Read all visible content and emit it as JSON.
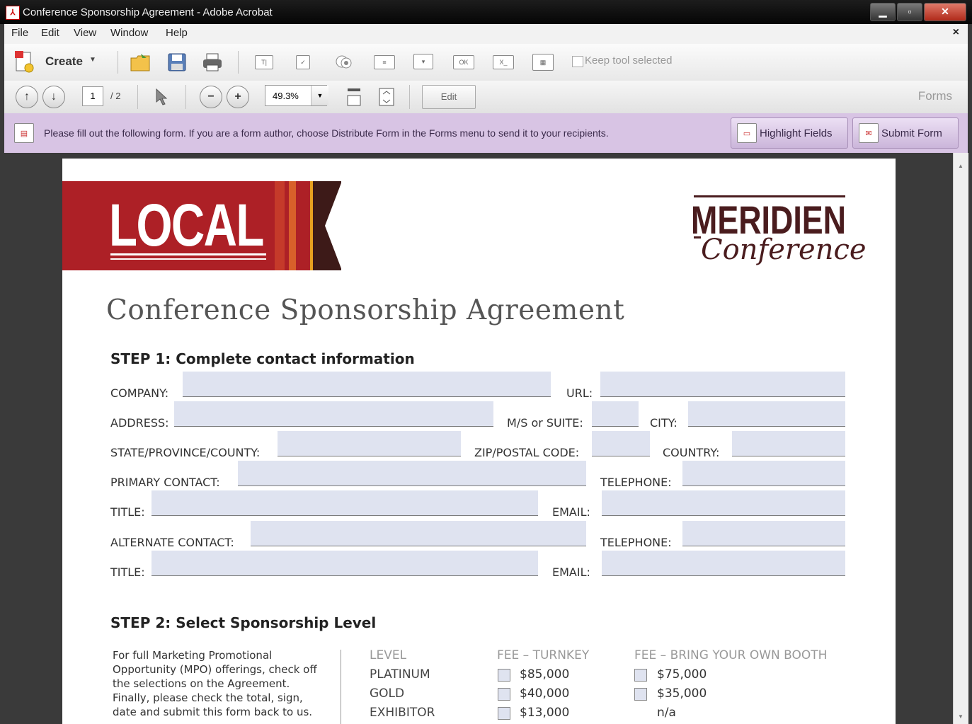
{
  "window": {
    "title": "Conference Sponsorship Agreement - Adobe Acrobat",
    "app_icon": "adobe-pdf-icon"
  },
  "menu": {
    "items": [
      "File",
      "Edit",
      "View",
      "Window",
      "Help"
    ],
    "close": "×"
  },
  "toolbar": {
    "create_label": "Create",
    "keep_tool_label": "Keep tool selected"
  },
  "nav": {
    "page_current": "1",
    "page_total": "/ 2",
    "zoom": "49.3%",
    "edit_label": "Edit",
    "forms_label": "Forms"
  },
  "formsbar": {
    "message": "Please fill out the following form. If you are a form author, choose Distribute Form in the Forms menu to send it to your recipients.",
    "highlight_label": "Highlight Fields",
    "submit_label": "Submit Form"
  },
  "document": {
    "banner_text": "LOCAL",
    "brand_main": "MERIDIEN",
    "brand_sub": "Conference",
    "title": "Conference Sponsorship Agreement",
    "step1": "STEP 1: Complete contact information",
    "labels": {
      "company": "COMPANY:",
      "url": "URL:",
      "address": "ADDRESS:",
      "suite": "M/S or SUITE:",
      "city": "CITY:",
      "state": "STATE/PROVINCE/COUNTY:",
      "zip": "ZIP/POSTAL CODE:",
      "country": "COUNTRY:",
      "primary": "PRIMARY CONTACT:",
      "telephone1": "TELEPHONE:",
      "title1": "TITLE:",
      "email1": "EMAIL:",
      "alternate": "ALTERNATE CONTACT:",
      "telephone2": "TELEPHONE:",
      "title2": "TITLE:",
      "email2": "EMAIL:"
    },
    "step2": "STEP 2: Select Sponsorship Level",
    "instructions": "For full Marketing Promotional Opportunity (MPO) offerings, check off the selections on the Agreement. Finally, please check the total, sign, date and submit this form back to us.",
    "table": {
      "col_level": "LEVEL",
      "col_turnkey": "FEE – TURNKEY",
      "col_byob": "FEE – BRING YOUR OWN BOOTH",
      "rows": [
        {
          "level": "PLATINUM",
          "turnkey": "$85,000",
          "byob": "$75,000"
        },
        {
          "level": "GOLD",
          "turnkey": "$40,000",
          "byob": "$35,000"
        },
        {
          "level": "EXHIBITOR",
          "turnkey": "$13,000",
          "byob": "n/a"
        }
      ]
    }
  }
}
